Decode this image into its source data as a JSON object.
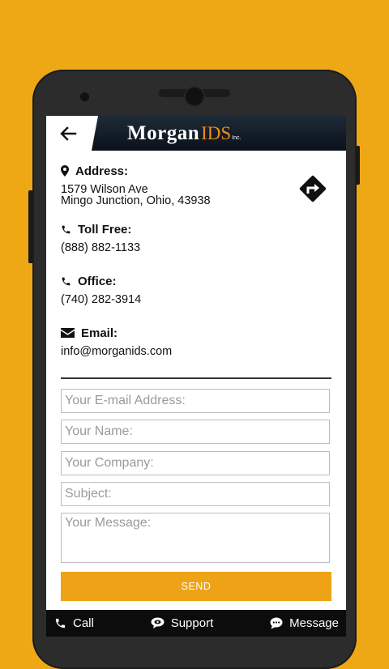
{
  "header": {
    "logo_main": "Morgan",
    "logo_sub": "IDS",
    "logo_inc": "Inc."
  },
  "contact": {
    "address_label": "Address:",
    "address_line1": "1579 Wilson Ave",
    "address_line2": "Mingo Junction, Ohio, 43938",
    "tollfree_label": "Toll Free:",
    "tollfree_value": "(888) 882-1133",
    "office_label": "Office:",
    "office_value": "(740) 282-3914",
    "email_label": "Email:",
    "email_value": "info@morganids.com"
  },
  "form": {
    "email_placeholder": "Your E-mail Address:",
    "name_placeholder": "Your Name:",
    "company_placeholder": "Your Company:",
    "subject_placeholder": "Subject:",
    "message_placeholder": "Your Message:",
    "send_label": "SEND"
  },
  "bottom_bar": {
    "call_label": "Call",
    "support_label": "Support",
    "message_label": "Message"
  },
  "colors": {
    "background": "#eea816",
    "accent": "#eea317",
    "logo_accent": "#ef8a1d",
    "header_dark": "#0b1119"
  }
}
